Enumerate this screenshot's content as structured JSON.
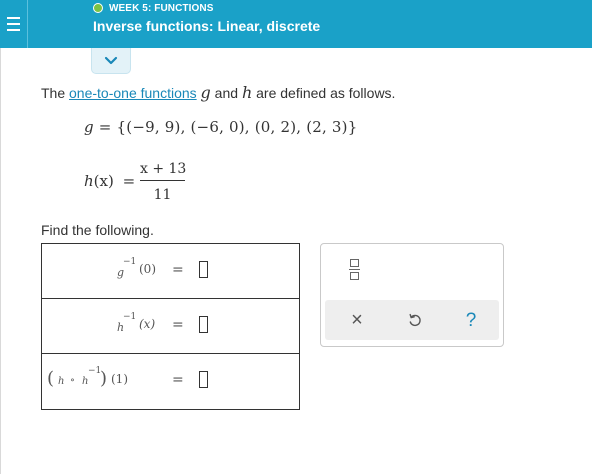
{
  "header": {
    "week_label": "WEEK 5: FUNCTIONS",
    "topic_title": "Inverse functions: Linear, discrete",
    "status_color": "#7cc244",
    "background_color": "#1aa1c8"
  },
  "icons": {
    "menu": "hamburger-menu-icon",
    "collapse": "chevron-down-icon",
    "fraction_tool": "fraction-icon",
    "clear": "close-icon",
    "undo": "undo-icon",
    "help": "help-icon"
  },
  "problem": {
    "intro_before": "The ",
    "intro_link": "one-to-one functions",
    "intro_g": "g",
    "intro_and": " and ",
    "intro_h": "h",
    "intro_after": " are defined as follows.",
    "g_name": "g",
    "g_equals": " = ",
    "g_set": "{(−9, 9), (−6, 0), (0, 2), (2, 3)}",
    "h_name": "h",
    "h_arg": "(x)",
    "h_equals": "=",
    "h_numerator": "x + 13",
    "h_denominator": "11",
    "find_label": "Find the following."
  },
  "answers": [
    {
      "func": "g",
      "inv_sup": "−1",
      "arg": "(0)",
      "equals": "=",
      "value": ""
    },
    {
      "func": "h",
      "inv_sup": "−1",
      "arg": "(x)",
      "equals": "=",
      "value": ""
    },
    {
      "open_paren": "(",
      "func_left": "h",
      "compose": "∘",
      "func_right": "h",
      "inv_sup": "−1",
      "close_paren": ")",
      "arg": "(1)",
      "equals": "=",
      "value": ""
    }
  ],
  "tools": {
    "clear_symbol": "×",
    "help_symbol": "?"
  }
}
